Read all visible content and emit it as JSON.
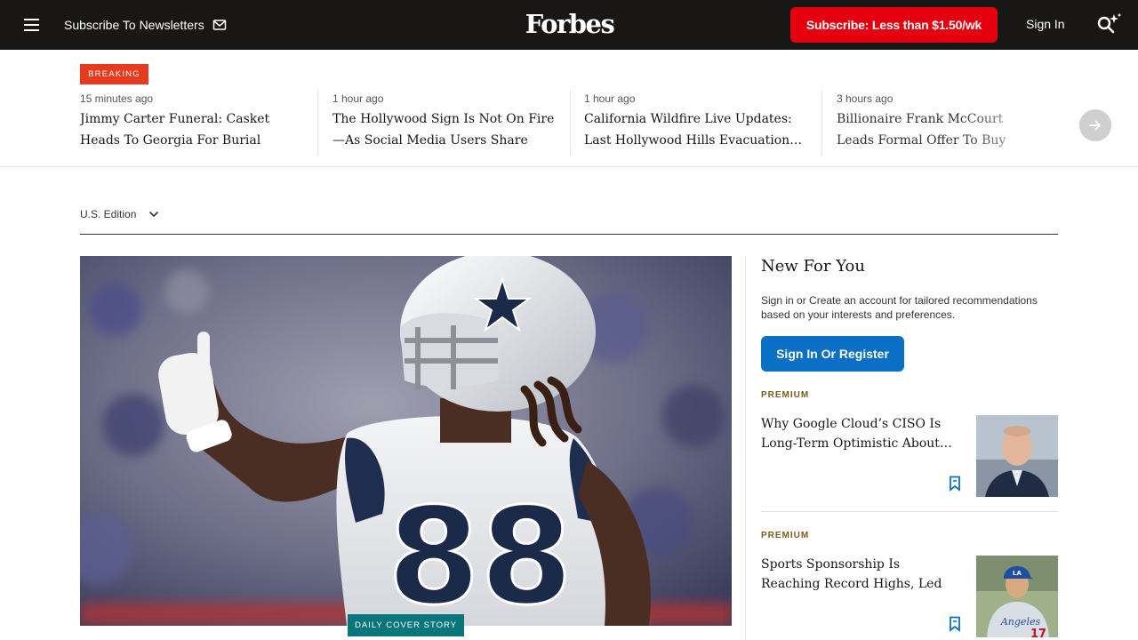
{
  "header": {
    "newsletter_label": "Subscribe To Newsletters",
    "logo_text": "Forbes",
    "subscribe_label": "Subscribe: Less than $1.50/wk",
    "signin_label": "Sign In"
  },
  "breaking": {
    "badge": "BREAKING",
    "items": [
      {
        "time": "15 minutes ago",
        "headline": "Jimmy Carter Funeral: Casket Heads To Georgia For Burial (Live…"
      },
      {
        "time": "1 hour ago",
        "headline": "The Hollywood Sign Is Not On Fire—As Social Media Users Share AI-…"
      },
      {
        "time": "1 hour ago",
        "headline": "California Wildfire Live Updates: Last Hollywood Hills Evacuation…"
      },
      {
        "time": "3 hours ago",
        "headline": "Billionaire Frank McCourt Leads Formal Offer To Buy TikTok—…"
      }
    ]
  },
  "edition": {
    "label": "U.S. Edition"
  },
  "hero": {
    "badge": "DAILY COVER STORY",
    "jersey_number": "88"
  },
  "sidebar": {
    "title": "New For You",
    "description": "Sign in or Create an account for tailored recommendations based on your interests and preferences.",
    "register_label": "Sign In Or Register",
    "articles": [
      {
        "label": "PREMIUM",
        "title": "Why Google Cloud’s CISO Is Long-Term Optimistic About…"
      },
      {
        "label": "PREMIUM",
        "title": "Sports Sponsorship Is Reaching Record Highs, Led By Shohei…",
        "jersey_text": "Angeles",
        "jersey_number": "17"
      }
    ]
  },
  "colors": {
    "header_bg": "#181716",
    "subscribe_red": "#e4000f",
    "breaking_red": "#e83a1f",
    "register_blue": "#0b6fc5",
    "cover_teal": "#08767b",
    "premium_gold": "#7a5b1d"
  }
}
